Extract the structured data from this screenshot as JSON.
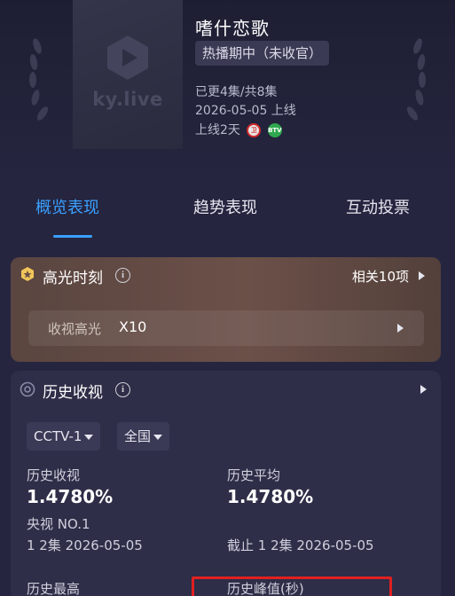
{
  "show": {
    "poster_logo": "ky.live",
    "title": "嗜什恋歌",
    "status": "热播期中（未收官）",
    "episodes": "已更4集/共8集",
    "release": "2026-05-05 上线",
    "days_online": "上线2天",
    "channel_badges": [
      {
        "name": "卫视台标",
        "text": "卫",
        "color": "#d12b2b"
      },
      {
        "name": "BTV台标",
        "text": "BTV",
        "color": "#2fa84f"
      }
    ]
  },
  "tabs": [
    {
      "label": "概览表现",
      "active": true
    },
    {
      "label": "趋势表现",
      "active": false
    },
    {
      "label": "互动投票",
      "active": false
    }
  ],
  "highlight": {
    "title": "高光时刻",
    "info": "i",
    "related": "相关10项",
    "row_label": "收视高光",
    "row_value": "X10"
  },
  "history": {
    "title": "历史收视",
    "info": "i",
    "channel_select": "CCTV-1",
    "region_select": "全国",
    "stats": {
      "hist_rating_label": "历史收视",
      "hist_rating_value": "1.4780%",
      "hist_rating_rank": "央视 NO.1",
      "hist_rating_ep": "1 2集  2026-05-05",
      "hist_avg_label": "历史平均",
      "hist_avg_value": "1.4780%",
      "hist_avg_ep": "截止 1 2集  2026-05-05",
      "hist_max_label": "历史最高",
      "hist_peak_label": "历史峰值(秒)"
    }
  },
  "colors": {
    "accent": "#3aa0ff",
    "background": "#252540",
    "highlight_card": "#6b5048",
    "annotation_box": "#e02020"
  }
}
